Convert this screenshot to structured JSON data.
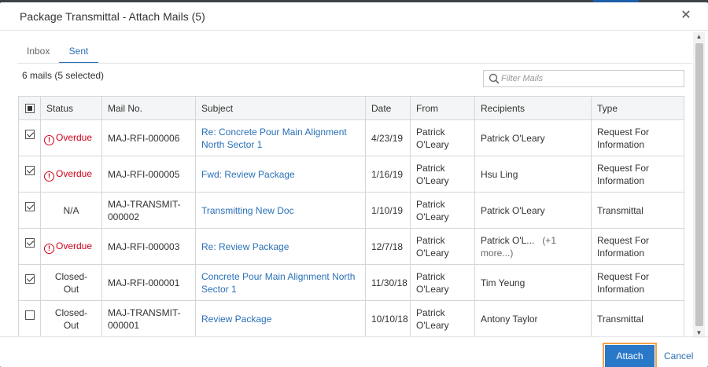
{
  "dialog": {
    "title": "Package Transmittal - Attach Mails (5)",
    "close_glyph": "✕"
  },
  "tabs": [
    {
      "label": "Inbox",
      "active": false
    },
    {
      "label": "Sent",
      "active": true
    }
  ],
  "summary": "6 mails (5 selected)",
  "filter": {
    "placeholder": "Filter Mails",
    "value": ""
  },
  "columns": [
    "Status",
    "Mail No.",
    "Subject",
    "Date",
    "From",
    "Recipients",
    "Type"
  ],
  "rows": [
    {
      "checked": true,
      "status": "Overdue",
      "status_kind": "overdue",
      "mail_no": "MAJ-RFI-000006",
      "subject": "Re: Concrete Pour Main Alignment North Sector 1",
      "date": "4/23/19",
      "from": "Patrick O'Leary",
      "recipients": "Patrick O'Leary",
      "more": "",
      "type": "Request For Information"
    },
    {
      "checked": true,
      "status": "Overdue",
      "status_kind": "overdue",
      "mail_no": "MAJ-RFI-000005",
      "subject": "Fwd: Review Package",
      "date": "1/16/19",
      "from": "Patrick O'Leary",
      "recipients": "Hsu Ling",
      "more": "",
      "type": "Request For Information"
    },
    {
      "checked": true,
      "status": "N/A",
      "status_kind": "plain",
      "mail_no": "MAJ-TRANSMIT-000002",
      "subject": "Transmitting New Doc",
      "date": "1/10/19",
      "from": "Patrick O'Leary",
      "recipients": "Patrick O'Leary",
      "more": "",
      "type": "Transmittal"
    },
    {
      "checked": true,
      "status": "Overdue",
      "status_kind": "overdue",
      "mail_no": "MAJ-RFI-000003",
      "subject": "Re: Review Package",
      "date": "12/7/18",
      "from": "Patrick O'Leary",
      "recipients": "Patrick O'L...",
      "more": "(+1 more...)",
      "type": "Request For Information"
    },
    {
      "checked": true,
      "status": "Closed-Out",
      "status_kind": "plain",
      "mail_no": "MAJ-RFI-000001",
      "subject": "Concrete Pour Main Alignment North Sector 1",
      "date": "11/30/18",
      "from": "Patrick O'Leary",
      "recipients": "Tim Yeung",
      "more": "",
      "type": "Request For Information"
    },
    {
      "checked": false,
      "status": "Closed-Out",
      "status_kind": "plain",
      "mail_no": "MAJ-TRANSMIT-000001",
      "subject": "Review Package",
      "date": "10/10/18",
      "from": "Patrick O'Leary",
      "recipients": "Antony Taylor",
      "more": "",
      "type": "Transmittal"
    }
  ],
  "buttons": {
    "attach": "Attach",
    "cancel": "Cancel"
  },
  "colors": {
    "accent": "#2a70b8",
    "overdue": "#d0021b",
    "focus_ring": "#f5a24a"
  },
  "icons": {
    "warning": "!",
    "search": "search-icon"
  }
}
